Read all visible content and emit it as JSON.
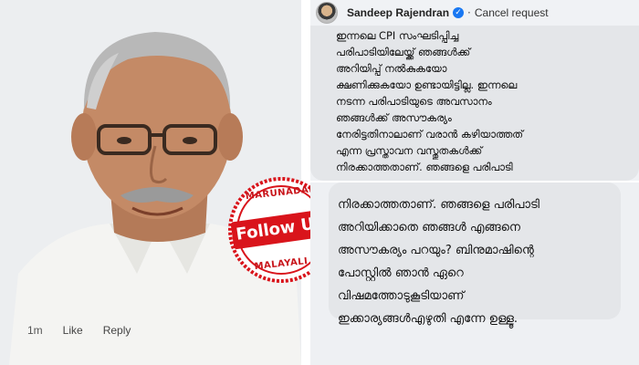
{
  "stamp": {
    "top_text": "MARUNADAN",
    "main_text": "Follow UP",
    "bottom_text": "MALAYALI"
  },
  "comment": {
    "author": "Sandeep Rajendran",
    "verified_icon": "check-badge",
    "separator": "·",
    "cancel_request": "Cancel request",
    "text_top": "ഇന്നലെ CPI സംഘടിപ്പിച്ച\nപരിപാടിയിലേയ്ക്ക് ഞങ്ങൾക്ക്\nഅറിയിപ്പ് നൽകുകയോ\nക്ഷണിക്കുകയോ ഉണ്ടായിട്ടില്ല. ഇന്നലെ\nനടന്ന പരിപാടിയുടെ അവസാനം\nഞങ്ങൾക്ക് അസൗകര്യം\nനേരിട്ടതിനാലാണ് വരാൻ കഴിയാത്തത്\nഎന്ന പ്രസ്താവന വസ്തുതകൾക്ക്\nനിരക്കാത്തതാണ്. ഞങ്ങളെ പരിപാടി",
    "text_bottom": "നിരക്കാത്തതാണ്. ഞങ്ങളെ പരിപാടി\nഅറിയിക്കാതെ ഞങ്ങൾ എങ്ങനെ\nഅസൗകര്യം പറയും? ബിനുമാഷിന്റെ\nപോസ്റ്റിൽ ഞാൻ ഏറെ\nവിഷമത്തോടുകൂടിയാണ്\nഇക്കാര്യങ്ങൾഎഴുതി എന്നേ ഉള്ളൂ.",
    "time": "1m",
    "like": "Like",
    "reply": "Reply"
  },
  "colors": {
    "stamp_red": "#d9141b",
    "bubble_bg": "#e4e6e9",
    "verified_blue": "#1877f2"
  }
}
